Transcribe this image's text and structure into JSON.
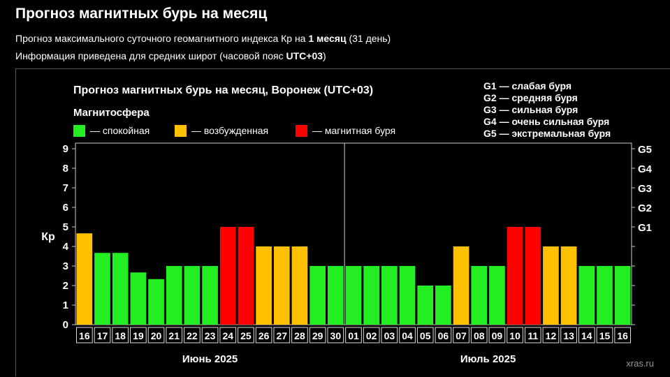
{
  "header": {
    "title": "Прогноз магнитных бурь на месяц",
    "subline1_prefix": "Прогноз максимального суточного геомагнитного индекса Кр на ",
    "subline1_bold": "1 месяц",
    "subline1_suffix": " (31 день)",
    "subline2_prefix": "Информация приведена для средних широт (часовой пояс ",
    "subline2_bold": "UTC+03",
    "subline2_suffix": ")"
  },
  "colors": {
    "calm": "#22ee22",
    "excited": "#ffc000",
    "storm": "#ff0000"
  },
  "chart_data": {
    "type": "bar",
    "title": "Прогноз магнитных бурь на месяц, Воронеж (UTC+03)",
    "ylabel": "Кр",
    "ylim": [
      0,
      9
    ],
    "yticks": [
      "0",
      "1",
      "2",
      "3",
      "4",
      "5",
      "6",
      "7",
      "8",
      "9"
    ],
    "g_scale": [
      {
        "label": "G1",
        "kp": 5
      },
      {
        "label": "G2",
        "kp": 6
      },
      {
        "label": "G3",
        "kp": 7
      },
      {
        "label": "G4",
        "kp": 8
      },
      {
        "label": "G5",
        "kp": 9
      }
    ],
    "storm_legend": [
      "G1 — слабая буря",
      "G2 — средняя буря",
      "G3 — сильная буря",
      "G4 — очень сильная буря",
      "G5 — экстремальная буря"
    ],
    "legend_title": "Магнитосфера",
    "legend": [
      {
        "key": "calm",
        "label": "— спокойная"
      },
      {
        "key": "excited",
        "label": "— возбужденная"
      },
      {
        "key": "storm",
        "label": "— магнитная буря"
      }
    ],
    "months": [
      {
        "label": "Июнь 2025",
        "days": 15
      },
      {
        "label": "Июль 2025",
        "days": 16
      }
    ],
    "categories": [
      "16",
      "17",
      "18",
      "19",
      "20",
      "21",
      "22",
      "23",
      "24",
      "25",
      "26",
      "27",
      "28",
      "29",
      "30",
      "01",
      "02",
      "03",
      "04",
      "05",
      "06",
      "07",
      "08",
      "09",
      "10",
      "11",
      "12",
      "13",
      "14",
      "15",
      "16"
    ],
    "values": [
      4.67,
      3.67,
      3.67,
      2.67,
      2.33,
      3,
      3,
      3,
      5,
      5,
      4,
      4,
      4,
      3,
      3,
      3,
      3,
      3,
      3,
      2,
      2,
      4,
      3,
      3,
      5,
      5,
      4,
      4,
      3,
      3,
      3
    ],
    "status": [
      "excited",
      "calm",
      "calm",
      "calm",
      "calm",
      "calm",
      "calm",
      "calm",
      "storm",
      "storm",
      "excited",
      "excited",
      "excited",
      "calm",
      "calm",
      "calm",
      "calm",
      "calm",
      "calm",
      "calm",
      "calm",
      "excited",
      "calm",
      "calm",
      "storm",
      "storm",
      "excited",
      "excited",
      "calm",
      "calm",
      "calm"
    ],
    "watermark": "xras.ru"
  }
}
